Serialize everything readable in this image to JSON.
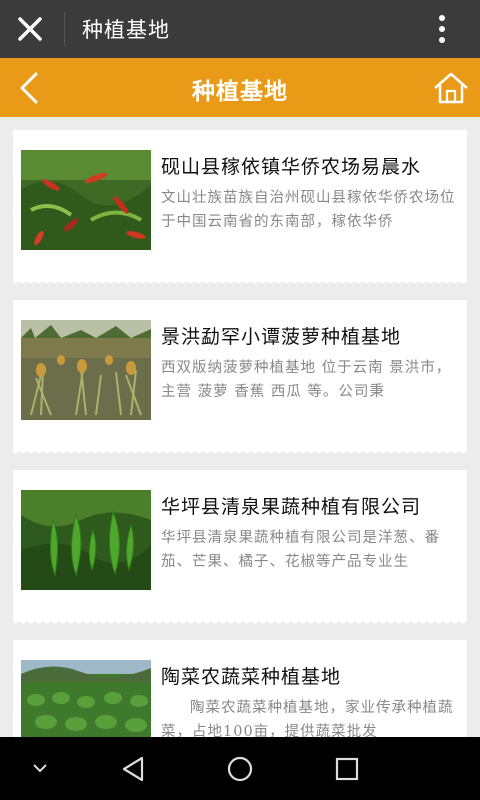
{
  "topbar": {
    "title": "种植基地",
    "close_icon": "close-icon",
    "more_icon": "more-vertical-icon"
  },
  "header": {
    "title": "种植基地",
    "back_icon": "chevron-left-icon",
    "home_icon": "home-icon",
    "color": "#e99a17"
  },
  "items": [
    {
      "name": "砚山县稼依镇华侨农场易晨水",
      "desc": "文山壮族苗族自治州砚山县稼依华侨农场位于中国云南省的东南部，稼依华侨",
      "image": "red-chili-pepper-field"
    },
    {
      "name": "景洪勐罕小谭菠萝种植基地",
      "desc": "西双版纳菠萝种植基地 位于云南 景洪市，主营 菠萝 香蕉 西瓜 等。公司秉",
      "image": "pineapple-plantation"
    },
    {
      "name": "华坪县清泉果蔬种植有限公司",
      "desc": "华坪县清泉果蔬种植有限公司是洋葱、番茄、芒果、橘子、花椒等产品专业生",
      "image": "green-chili-pepper-plants"
    },
    {
      "name": "陶菜农蔬菜种植基地",
      "desc": "陶菜农蔬菜种植基地，家业传承种植蔬菜，占地100亩，提供蔬菜批发",
      "image": "vegetable-field"
    }
  ],
  "navbar": {
    "back_icon": "triangle-back-icon",
    "home_icon": "circle-home-icon",
    "recents_icon": "square-recents-icon",
    "collapse_icon": "chevron-down-icon"
  }
}
